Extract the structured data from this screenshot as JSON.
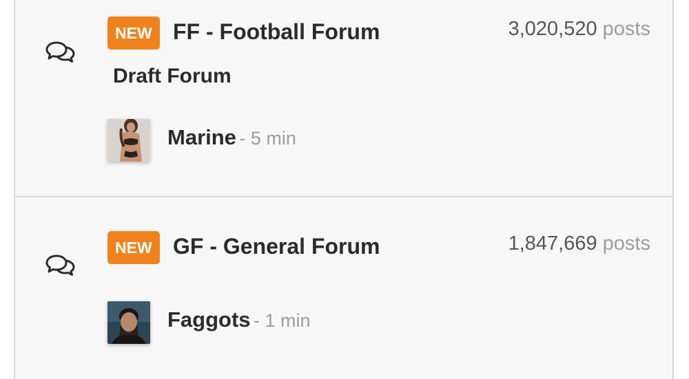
{
  "forums": [
    {
      "badge": "NEW",
      "title": "FF - Football Forum",
      "post_count": "3,020,520",
      "post_unit": "posts",
      "subforum": "Draft Forum",
      "last_post": {
        "user": "Marine",
        "time": "- 5 min"
      }
    },
    {
      "badge": "NEW",
      "title": "GF - General Forum",
      "post_count": "1,847,669",
      "post_unit": "posts",
      "last_post": {
        "user": "Faggots",
        "time": "- 1 min"
      }
    }
  ],
  "icons": {
    "forum_icon": "chat-bubbles-icon"
  },
  "colors": {
    "badge": "#f0821e",
    "title_text": "#2b2b2b",
    "muted_text": "#9c9c9c",
    "count_text": "#555555",
    "background": "#f7f7f7",
    "divider": "#d8d8d8"
  }
}
